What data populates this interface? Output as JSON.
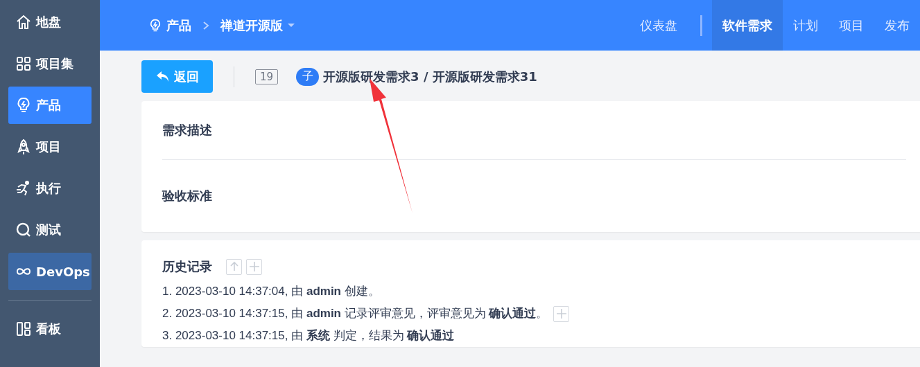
{
  "sidebar": {
    "items": [
      {
        "label": "地盘",
        "selected": false
      },
      {
        "label": "项目集",
        "selected": false
      },
      {
        "label": "产品",
        "selected": true
      },
      {
        "label": "项目",
        "selected": false
      },
      {
        "label": "执行",
        "selected": false
      },
      {
        "label": "测试",
        "selected": false
      },
      {
        "label": "DevOps",
        "selected": false,
        "highlighted": true
      }
    ],
    "bottom_items": [
      {
        "label": "看板",
        "selected": false
      }
    ]
  },
  "header": {
    "breadcrumb": [
      "产品",
      "禅道开源版"
    ],
    "nav": [
      {
        "label": "仪表盘",
        "selected": false
      },
      {
        "label": "软件需求",
        "selected": true
      },
      {
        "label": "计划",
        "selected": false
      },
      {
        "label": "项目",
        "selected": false
      },
      {
        "label": "发布",
        "selected": false
      }
    ]
  },
  "toolbar": {
    "back_button": "返回",
    "id": "19",
    "child_badge": "子",
    "title": "开源版研发需求3 / 开源版研发需求31"
  },
  "sections": [
    "需求描述",
    "验收标准"
  ],
  "history": {
    "title": "历史记录",
    "entries": [
      {
        "text": "1. 2023-03-10 14:37:04, 由 **admin** 创建。",
        "expandable": false
      },
      {
        "text": "2. 2023-03-10 14:37:15, 由 **admin** 记录评审意见，评审意见为 **确认通过**。",
        "expandable": true
      },
      {
        "text": "3. 2023-03-10 14:37:15, 由 **系统** 判定，结果为 **确认通过**",
        "expandable": false
      }
    ]
  }
}
